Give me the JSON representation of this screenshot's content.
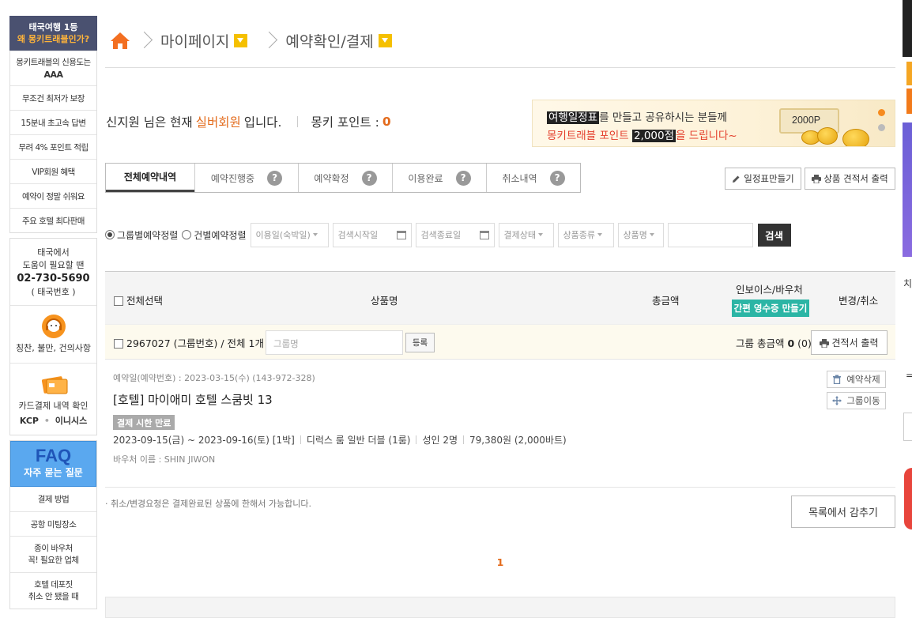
{
  "sidebar": {
    "promo": {
      "line1": "태국여행 1등",
      "line2": "왜 몽키트래블인가?"
    },
    "items": [
      {
        "label": "몽키트래블의 신용도는",
        "bold": "AAA"
      },
      {
        "label": "무조건 최저가 보장"
      },
      {
        "label": "15분내 초고속 답변"
      },
      {
        "label": "무려 4% 포인트 적립"
      },
      {
        "label": "VIP회원 혜택"
      },
      {
        "label": "예약이 정말 쉬워요"
      },
      {
        "label": "주요 호텔 최다판매"
      }
    ],
    "contact": {
      "line1": "태국에서",
      "line2": "도움이 필요할 땐",
      "phone": "02-730-5690",
      "phone_note": "( 태국번호 )",
      "feedback": "칭찬, 불만, 건의사항",
      "card_line1": "카드결제 내역 확인",
      "kcp": "KCP",
      "inicis": "이니시스"
    },
    "faq": {
      "title": "FAQ",
      "subtitle": "자주 묻는 질문",
      "items": [
        {
          "label": "결제 방법"
        },
        {
          "label": "공항 미팅장소"
        },
        {
          "label1": "종이 바우처",
          "label2": "꼭! 필요한 업체"
        },
        {
          "label1": "호텔 데포짓",
          "label2": "취소 안 됐을 때"
        }
      ]
    }
  },
  "breadcrumb": {
    "level1": "마이페이지",
    "level2": "예약확인/결제"
  },
  "member": {
    "prefix": "신지원 님은 현재",
    "grade": "실버회원",
    "suffix": "입니다.",
    "points_label": "몽키 포인트 :",
    "points": "0"
  },
  "banner": {
    "hl1": "여행일정표",
    "rest1": "를 만들고 공유하시는 분들께",
    "pre2": "몽키트래블 포인트",
    "hl2": "2,000점",
    "rest2": "을 드립니다~",
    "coupon": "2000P"
  },
  "tabs": [
    {
      "label": "전체예약내역",
      "active": true,
      "help": false
    },
    {
      "label": "예약진행중",
      "help": true
    },
    {
      "label": "예약확정",
      "help": true
    },
    {
      "label": "이용완료",
      "help": true
    },
    {
      "label": "취소내역",
      "help": true
    }
  ],
  "help_glyph": "?",
  "actions": {
    "itinerary": "일정표만들기",
    "quote_print": "상품 견적서 출력"
  },
  "filters": {
    "radio_group": "그룹별예약정렬",
    "radio_single": "건별예약정렬",
    "use_date": "이용일(숙박일)",
    "start_date": "검색시작일",
    "end_date": "검색종료일",
    "payment_status": "결제상태",
    "product_type": "상품종류",
    "product_name": "상품명",
    "search_btn": "검색"
  },
  "table_header": {
    "select_all": "전체선택",
    "product": "상품명",
    "total": "총금액",
    "invoice": "인보이스/바우처",
    "receipt_btn": "간편 영수증 만들기",
    "change": "변경/취소"
  },
  "group": {
    "id": "2967027 (그룹번호) / 전체 1개 /",
    "name_placeholder": "그룹명",
    "register_btn": "등록",
    "total_label": "그룹 총금액",
    "total_value": "0",
    "total_count": "(0)",
    "print_btn": "견적서 출력"
  },
  "reservation": {
    "date_line": "예약일(예약번호) : 2023-03-15(수) (143-972-328)",
    "title": "[호텔] 마이애미 호텔 스쿰빗 13",
    "status": "결제 시한 만료",
    "stay": "2023-09-15(금) ~ 2023-09-16(토) [1박]",
    "room": "디럭스 룸 일반 더블 (1룸)",
    "guests": "성인 2명",
    "price": "79,380원 (2,000바트)",
    "voucher": "바우처 이름 : SHIN JIWON",
    "delete_btn": "예약삭제",
    "move_btn": "그룹이동"
  },
  "note": "· 취소/변경요청은 결제완료된 상품에 한해서 가능합니다.",
  "hide_btn": "목록에서 감추기",
  "page": "1",
  "right_edge": {
    "char1": "치",
    "char2": "="
  },
  "colors": {
    "accent": "#e36b1c",
    "teal": "#2bb5a5",
    "promo_bg": "#4a5170",
    "faq_bg": "#5aa8ef"
  }
}
